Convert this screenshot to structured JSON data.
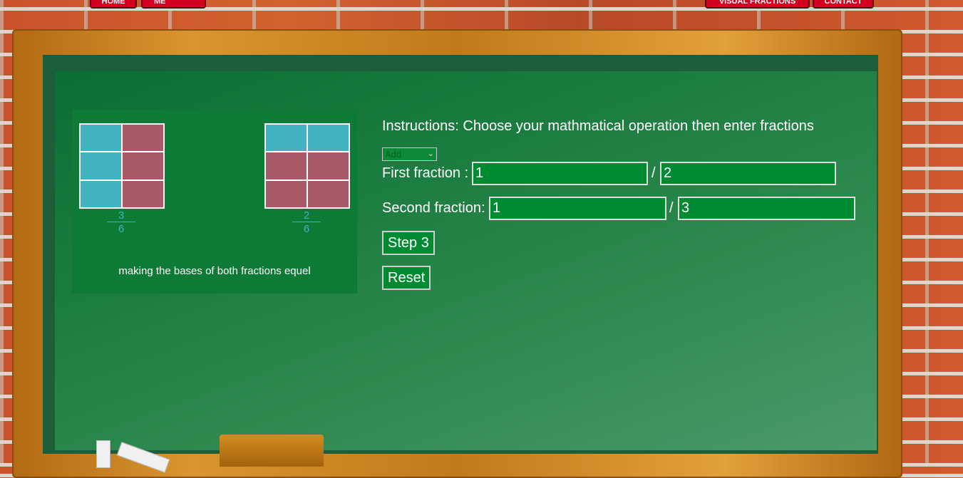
{
  "nav": {
    "left": [
      "HOME",
      "ABOUT ME"
    ],
    "right": [
      "VISUAL FRACTIONS",
      "CONTACT"
    ]
  },
  "visual": {
    "fraction1": {
      "numerator": "3",
      "denominator": "6"
    },
    "fraction2": {
      "numerator": "2",
      "denominator": "6"
    },
    "caption": "making the bases of both fractions equel"
  },
  "form": {
    "instructions": "Instructions: Choose your mathmatical operation then enter fractions",
    "operation": "Add",
    "first_label": "First fraction :",
    "first_num": "1",
    "first_den": "2",
    "second_label": "Second fraction:",
    "second_num": "1",
    "second_den": "3",
    "slash": "/",
    "step_button": "Step 3",
    "reset_button": "Reset"
  }
}
